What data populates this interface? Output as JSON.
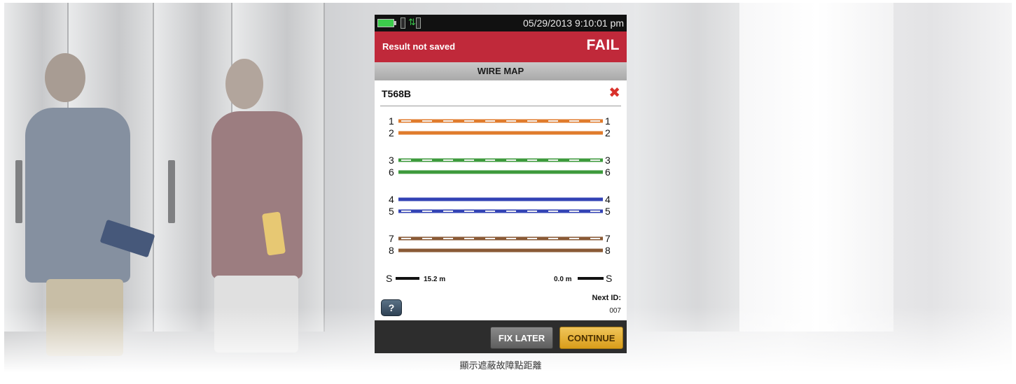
{
  "device": {
    "datetime": "05/29/2013 9:10:01 pm",
    "result_status": "Result not saved",
    "verdict": "FAIL",
    "screen_title": "WIRE MAP",
    "standard": "T568B",
    "standard_status_icon": "close-icon",
    "pairs": [
      {
        "color": "#e07b2c",
        "wires": [
          {
            "pin": "1",
            "striped": true
          },
          {
            "pin": "2",
            "striped": false
          }
        ]
      },
      {
        "color": "#3d9a3c",
        "wires": [
          {
            "pin": "3",
            "striped": true
          },
          {
            "pin": "6",
            "striped": false
          }
        ]
      },
      {
        "color": "#3343b5",
        "wires": [
          {
            "pin": "4",
            "striped": false
          },
          {
            "pin": "5",
            "striped": true
          }
        ]
      },
      {
        "color": "#8a5a36",
        "wires": [
          {
            "pin": "7",
            "striped": true
          },
          {
            "pin": "8",
            "striped": false
          }
        ]
      }
    ],
    "shield": {
      "label": "S",
      "near_distance": "15.2 m",
      "far_distance": "0.0 m"
    },
    "help_label": "?",
    "next_id_label": "Next ID:",
    "next_id_value": "007",
    "buttons": {
      "fix_later": "FIX LATER",
      "continue": "CONTINUE"
    },
    "colors": {
      "fail_banner": "#c0293a",
      "continue_button": "#e5b035",
      "battery": "#3ccc4c"
    }
  },
  "caption": "顯示遮蔽故障點距離"
}
